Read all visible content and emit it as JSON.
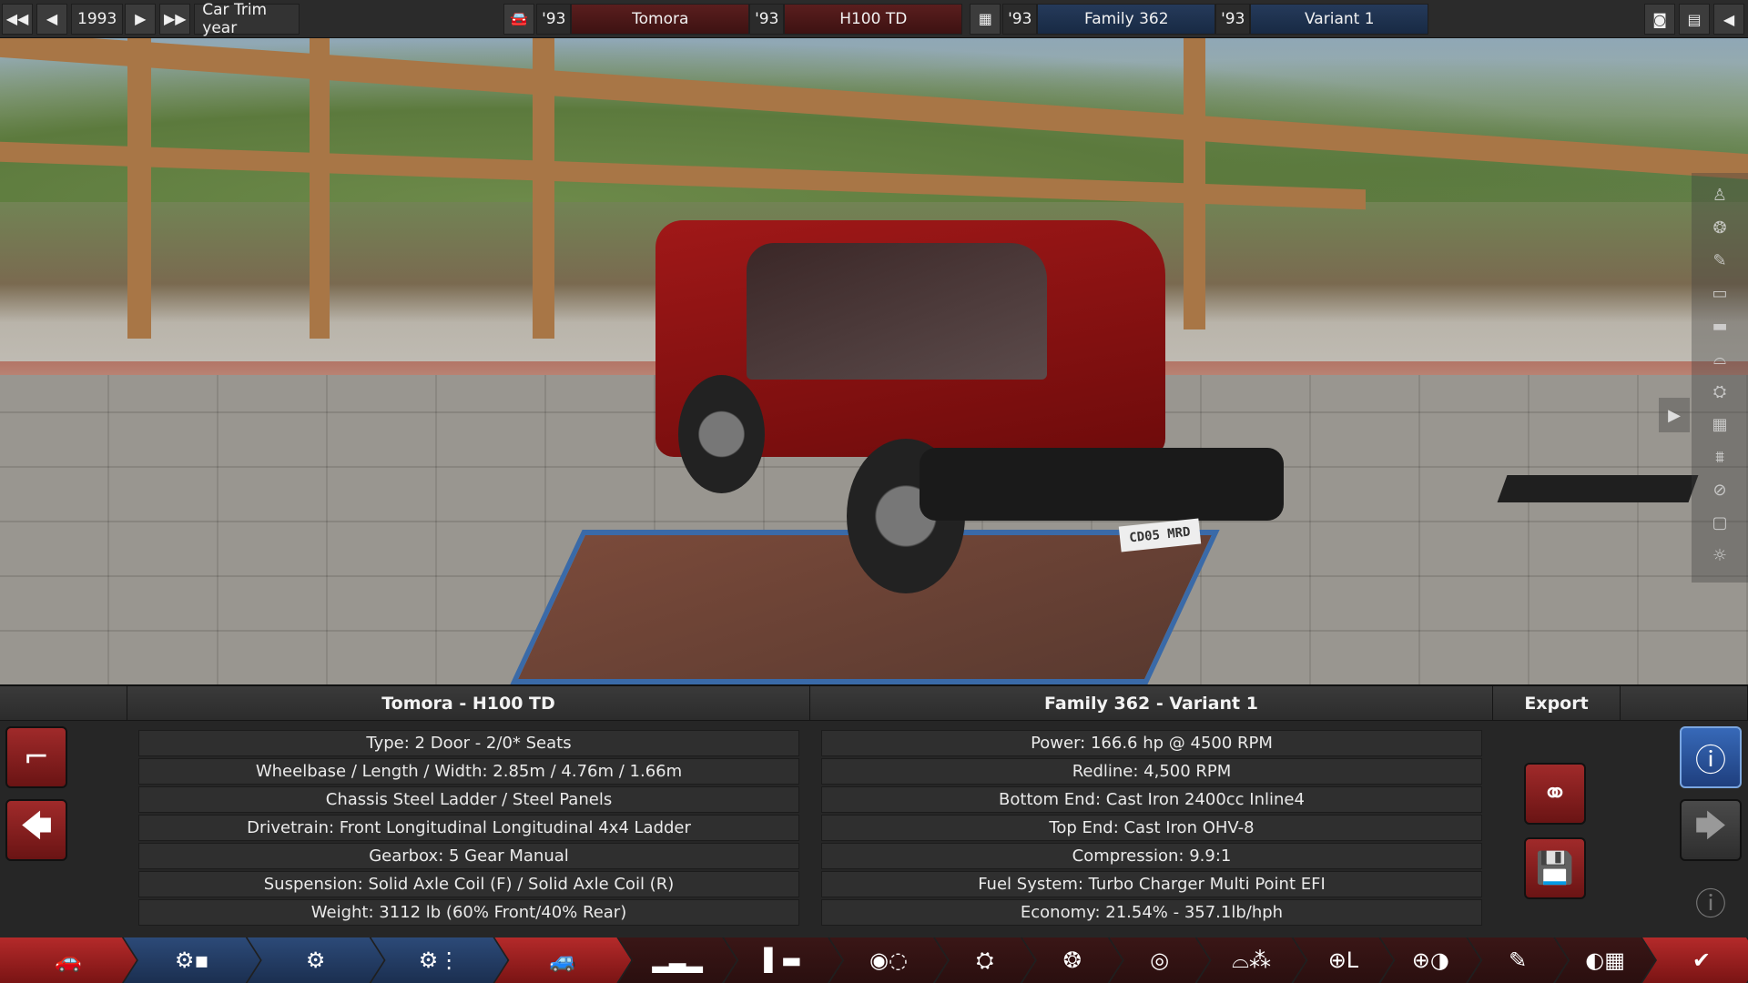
{
  "topbar": {
    "year_value": "1993",
    "mode_label": "Car Trim year",
    "model_year": "'93",
    "model_name": "Tomora",
    "trim_year": "'93",
    "trim_name": "H100 TD",
    "family_year": "'93",
    "family_name": "Family 362",
    "variant_year": "'93",
    "variant_name": "Variant 1"
  },
  "scene": {
    "plate_text": "CD05 MRD"
  },
  "panel": {
    "left_title": "Tomora - H100 TD",
    "right_title": "Family 362 - Variant 1",
    "export_title": "Export",
    "car_specs": [
      "Type: 2 Door - 2/0* Seats",
      "Wheelbase / Length / Width: 2.85m / 4.76m / 1.66m",
      "Chassis Steel Ladder / Steel Panels",
      "Drivetrain: Front Longitudinal Longitudinal 4x4 Ladder",
      "Gearbox: 5 Gear Manual",
      "Suspension: Solid Axle Coil (F) / Solid Axle Coil (R)",
      "Weight: 3112 lb (60% Front/40% Rear)"
    ],
    "engine_specs": [
      "Power: 166.6 hp @ 4500 RPM",
      "Redline:  4,500 RPM",
      "Bottom End: Cast Iron 2400cc Inline4",
      "Top End: Cast Iron OHV-8",
      "Compression: 9.9:1",
      "Fuel System: Turbo Charger Multi Point EFI",
      "Economy: 21.54% - 357.1lb/hph"
    ]
  },
  "colors": {
    "accent_red": "#a02a2a",
    "accent_blue": "#3769b8",
    "panel_bg": "#262626"
  }
}
